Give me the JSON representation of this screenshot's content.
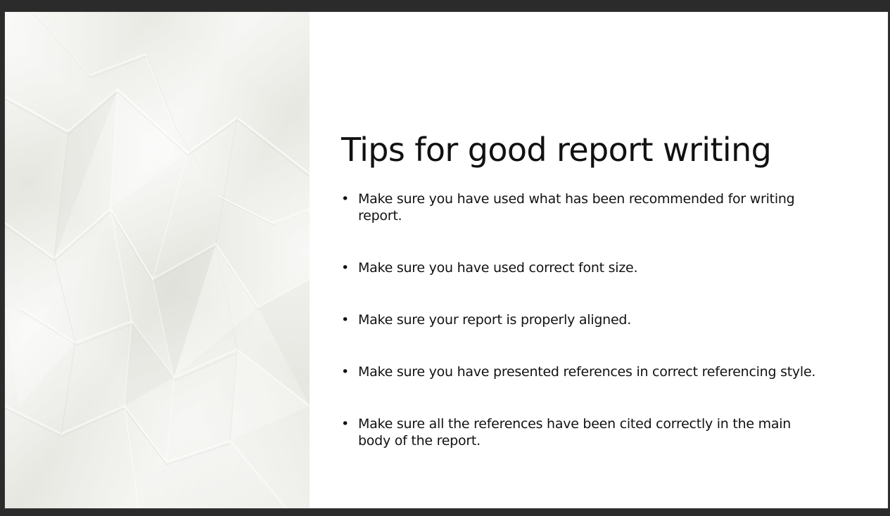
{
  "slide": {
    "title": "Tips for good report writing",
    "bullet_glyph": "•",
    "bullets": [
      {
        "text": "Make sure you have used what has been recommended for writing report."
      },
      {
        "text": "Make sure you have used correct font size."
      },
      {
        "text": "Make sure your report is properly aligned."
      },
      {
        "text": "Make sure you have presented references in correct referencing style."
      },
      {
        "text": "Make sure all the references have been cited correctly in the main body of the report."
      }
    ]
  },
  "colors": {
    "background": "#2b2b2b",
    "slide": "#ffffff",
    "text": "#111111",
    "paper": "#ececE8"
  }
}
